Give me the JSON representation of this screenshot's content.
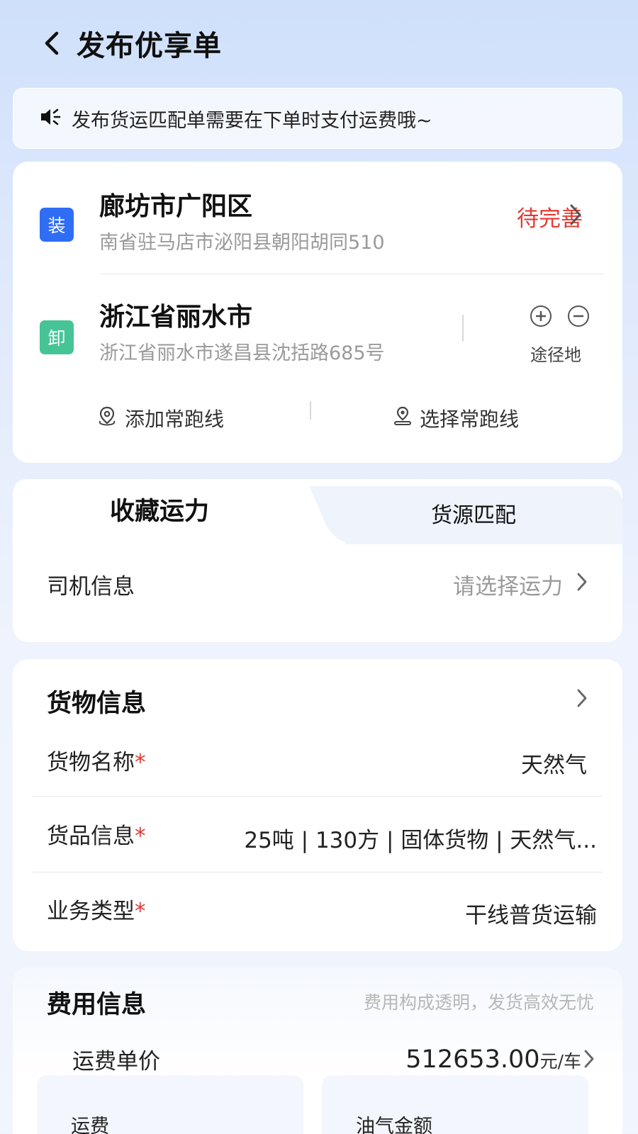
{
  "header": {
    "title": "发布优享单"
  },
  "notice": {
    "text": "发布货运匹配单需要在下单时支付运费哦~"
  },
  "route": {
    "load": {
      "tag": "装",
      "title": "廊坊市广阳区",
      "address": "南省驻马店市泌阳县朝阳胡同510",
      "status": "待完善"
    },
    "unload": {
      "tag": "卸",
      "title": "浙江省丽水市",
      "address": "浙江省丽水市遂昌县沈括路685号"
    },
    "waypoint_label": "途径地",
    "add_route_label": "添加常跑线",
    "select_route_label": "选择常跑线"
  },
  "capacity": {
    "tabs": [
      {
        "label": "收藏运力",
        "active": true
      },
      {
        "label": "货源匹配",
        "active": false
      }
    ],
    "driver_label": "司机信息",
    "driver_placeholder": "请选择运力"
  },
  "goods": {
    "title": "货物信息",
    "rows": [
      {
        "label": "货物名称",
        "required_mark": "*",
        "value": "天然气"
      },
      {
        "label": "货品信息",
        "required_mark": "*",
        "value": "25吨 | 130方 | 固体货物 | 天然气..."
      },
      {
        "label": "业务类型",
        "required_mark": "*",
        "value": "干线普货运输"
      }
    ]
  },
  "fee": {
    "title": "费用信息",
    "hint": "费用构成透明，发货高效无忧",
    "unit_price_label": "运费单价",
    "unit_price_value": "512653.00",
    "unit_price_unit": "元/车",
    "boxes": [
      {
        "label": "运费"
      },
      {
        "label": "油气金额"
      }
    ]
  },
  "colors": {
    "accent_blue": "#2f6df4",
    "unload_green": "#46c496",
    "alert_red": "#e23a32"
  }
}
